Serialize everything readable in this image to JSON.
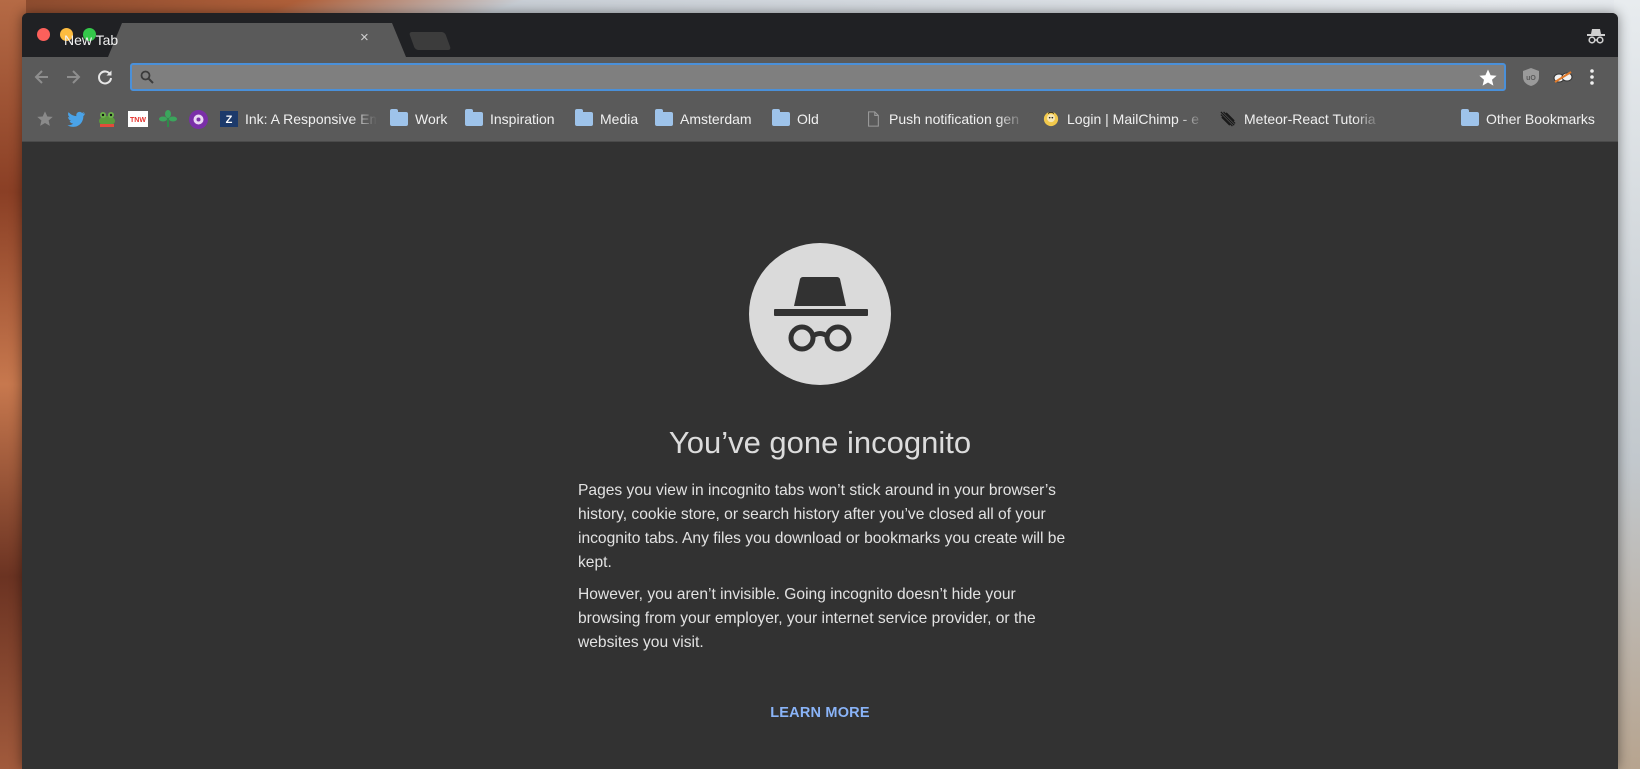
{
  "tab": {
    "title": "New Tab",
    "close_glyph": "×"
  },
  "colors": {
    "tabstrip": "#202124",
    "toolbar": "#5a5a5a",
    "content": "#323232",
    "link": "#8ab4f8",
    "omnibox_focus": "#4a90d9"
  },
  "omnibox": {
    "value": "",
    "placeholder": ""
  },
  "icons": {
    "back": "back-arrow-icon",
    "forward": "forward-arrow-icon",
    "reload": "reload-icon",
    "search": "search-icon",
    "bookmark_star": "star-icon",
    "menu": "kebab-menu-icon",
    "incognito": "incognito-icon"
  },
  "extensions": [
    "ublock-origin-icon",
    "extension-goggles-icon"
  ],
  "bookmarks": {
    "items": [
      {
        "label": "",
        "icon": "star-icon"
      },
      {
        "label": "",
        "icon": "twitter-icon"
      },
      {
        "label": "",
        "icon": "frog-icon"
      },
      {
        "label": "",
        "icon": "tnw-icon"
      },
      {
        "label": "",
        "icon": "plant-icon"
      },
      {
        "label": "",
        "icon": "flower-icon"
      },
      {
        "label": "Ink: A Responsive Em",
        "icon": "ink-icon"
      },
      {
        "label": "Work",
        "icon": "folder-icon"
      },
      {
        "label": "Inspiration",
        "icon": "folder-icon"
      },
      {
        "label": "Media",
        "icon": "folder-icon"
      },
      {
        "label": "Amsterdam",
        "icon": "folder-icon"
      },
      {
        "label": "Old",
        "icon": "folder-icon"
      },
      {
        "label": "Push notification gen",
        "icon": "page-icon"
      },
      {
        "label": "Login | MailChimp - e",
        "icon": "mailchimp-icon"
      },
      {
        "label": "Meteor-React Tutoria",
        "icon": "meteor-icon"
      }
    ],
    "other": "Other Bookmarks"
  },
  "page": {
    "headline": "You’ve gone incognito",
    "paragraph1": "Pages you view in incognito tabs won’t stick around in your browser’s history, cookie store, or search history after you’ve closed all of your incognito tabs. Any files you download or bookmarks you create will be kept.",
    "paragraph2": "However, you aren’t invisible. Going incognito doesn’t hide your browsing from your employer, your internet service provider, or the websites you visit.",
    "learn_more": "LEARN MORE"
  }
}
